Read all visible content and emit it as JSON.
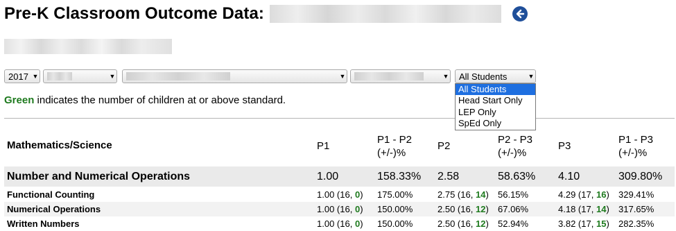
{
  "header": {
    "title": "Pre-K Classroom Outcome Data:"
  },
  "filters": {
    "year": "2017",
    "student_filter": "All Students",
    "student_options": [
      "All Students",
      "Head Start Only",
      "LEP Only",
      "SpEd Only"
    ]
  },
  "note": {
    "highlight": "Green",
    "text": " indicates the number of children at or above standard."
  },
  "table": {
    "category": "Mathematics/Science",
    "columns": [
      "P1",
      "P1 - P2\n(+/-)%",
      "P2",
      "P2 - P3\n(+/-)%",
      "P3",
      "P1 - P3\n(+/-)%"
    ],
    "group": {
      "label": "Number and Numerical Operations",
      "p1": "1.00",
      "p1p2": "158.33%",
      "p2": "2.58",
      "p2p3": "58.63%",
      "p3": "4.10",
      "p1p3": "309.80%"
    },
    "rows": [
      {
        "label": "Functional Counting",
        "p1_score": "1.00",
        "p1_n": "16",
        "p1_std": "0",
        "p1p2": "175.00%",
        "p2_score": "2.75",
        "p2_n": "16",
        "p2_std": "14",
        "p2p3": "56.15%",
        "p3_score": "4.29",
        "p3_n": "17",
        "p3_std": "16",
        "p1p3": "329.41%"
      },
      {
        "label": "Numerical Operations",
        "p1_score": "1.00",
        "p1_n": "16",
        "p1_std": "0",
        "p1p2": "150.00%",
        "p2_score": "2.50",
        "p2_n": "16",
        "p2_std": "12",
        "p2p3": "67.06%",
        "p3_score": "4.18",
        "p3_n": "17",
        "p3_std": "14",
        "p1p3": "317.65%"
      },
      {
        "label": "Written Numbers",
        "p1_score": "1.00",
        "p1_n": "16",
        "p1_std": "0",
        "p1p2": "150.00%",
        "p2_score": "2.50",
        "p2_n": "16",
        "p2_std": "12",
        "p2p3": "52.94%",
        "p3_score": "3.82",
        "p3_n": "17",
        "p3_std": "15",
        "p1p3": "282.35%"
      }
    ]
  }
}
